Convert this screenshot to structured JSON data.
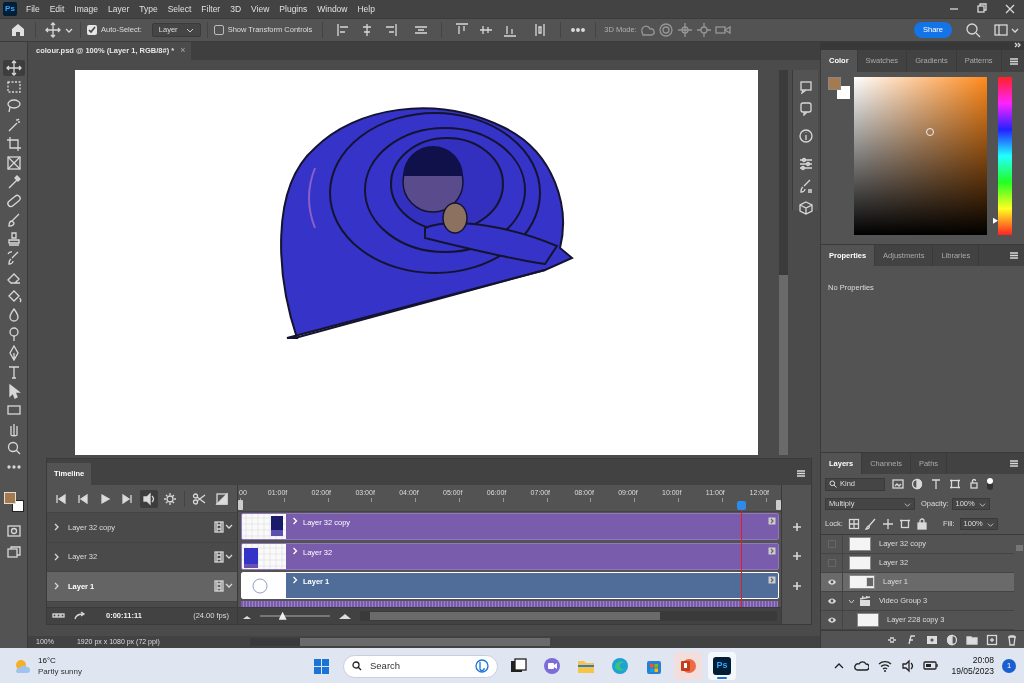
{
  "logo": "Ps",
  "menu": [
    "File",
    "Edit",
    "Image",
    "Layer",
    "Type",
    "Select",
    "Filter",
    "3D",
    "View",
    "Plugins",
    "Window",
    "Help"
  ],
  "options_bar": {
    "auto_select": {
      "label": "Auto-Select:",
      "checked": true
    },
    "target": "Layer",
    "transform_controls": {
      "label": "Show Transform Controls",
      "checked": false
    },
    "mode_label": "3D Mode:",
    "share": "Share"
  },
  "document": {
    "tab": "colour.psd @ 100% (Layer 1, RGB/8#) *",
    "close": "×"
  },
  "color_panel": {
    "hue": {
      "level": 0.09
    },
    "tabs": [
      {
        "label": "Color",
        "selected": true
      },
      {
        "label": "Swatches",
        "selected": false
      },
      {
        "label": "Gradients",
        "selected": false
      },
      {
        "label": "Patterns",
        "selected": false
      }
    ]
  },
  "properties_panel": {
    "tabs": [
      {
        "label": "Properties",
        "selected": true
      },
      {
        "label": "Adjustments",
        "selected": false
      },
      {
        "label": "Libraries",
        "selected": false
      }
    ],
    "message": "No Properties"
  },
  "timeline": {
    "title": "Timeline",
    "ruler": [
      "00",
      "01:00f",
      "02:00f",
      "03:00f",
      "04:00f",
      "05:00f",
      "06:00f",
      "07:00f",
      "08:00f",
      "09:00f",
      "10:00f",
      "11:00f",
      "12:00f"
    ],
    "tracks": [
      {
        "name": "Layer 32 copy",
        "clip_label": "Layer 32 copy",
        "selected": false
      },
      {
        "name": "Layer 32",
        "clip_label": "Layer 32",
        "selected": false
      },
      {
        "name": "Layer 1",
        "clip_label": "Layer 1",
        "selected": true
      }
    ],
    "time": "0:00:11:11",
    "fps": "(24.00 fps)",
    "zoom": {
      "level": 0.3
    }
  },
  "layers_panel": {
    "tabs": [
      {
        "label": "Layers",
        "selected": true
      },
      {
        "label": "Channels",
        "selected": false
      },
      {
        "label": "Paths",
        "selected": false
      }
    ],
    "filter": "Kind",
    "blend_mode": "Multiply",
    "opacity_label": "Opacity:",
    "opacity": "100%",
    "lock_label": "Lock:",
    "fill_label": "Fill:",
    "fill": "100%",
    "layers": [
      {
        "name": "Layer 32 copy",
        "kind": "layer",
        "visible": false,
        "selected": false
      },
      {
        "name": "Layer 32",
        "kind": "layer",
        "visible": false,
        "selected": false
      },
      {
        "name": "Layer 1",
        "kind": "video",
        "visible": true,
        "selected": true
      },
      {
        "name": "Video Group 3",
        "kind": "group",
        "visible": true,
        "selected": false,
        "expanded": true,
        "children": [
          {
            "name": "Layer 228 copy 3",
            "kind": "layer",
            "visible": true,
            "selected": false
          }
        ]
      }
    ]
  },
  "status_bar": {
    "zoom": "100%",
    "info": "1920 px x 1080 px (72 ppi)"
  },
  "taskbar": {
    "weather": {
      "temperature": "16°C",
      "condition": "Partly sunny"
    },
    "search": {
      "placeholder": "Search"
    },
    "apps": [
      {
        "kind": "taskview",
        "selected": false
      },
      {
        "kind": "chat",
        "selected": false
      },
      {
        "kind": "explorer",
        "selected": false
      },
      {
        "kind": "edge",
        "selected": false
      },
      {
        "kind": "store",
        "selected": false
      },
      {
        "kind": "powerpoint",
        "selected": false
      },
      {
        "kind": "photoshop",
        "label": "Ps",
        "selected": true
      }
    ],
    "time": "20:08",
    "date": "19/05/2023",
    "notifications": "1"
  }
}
